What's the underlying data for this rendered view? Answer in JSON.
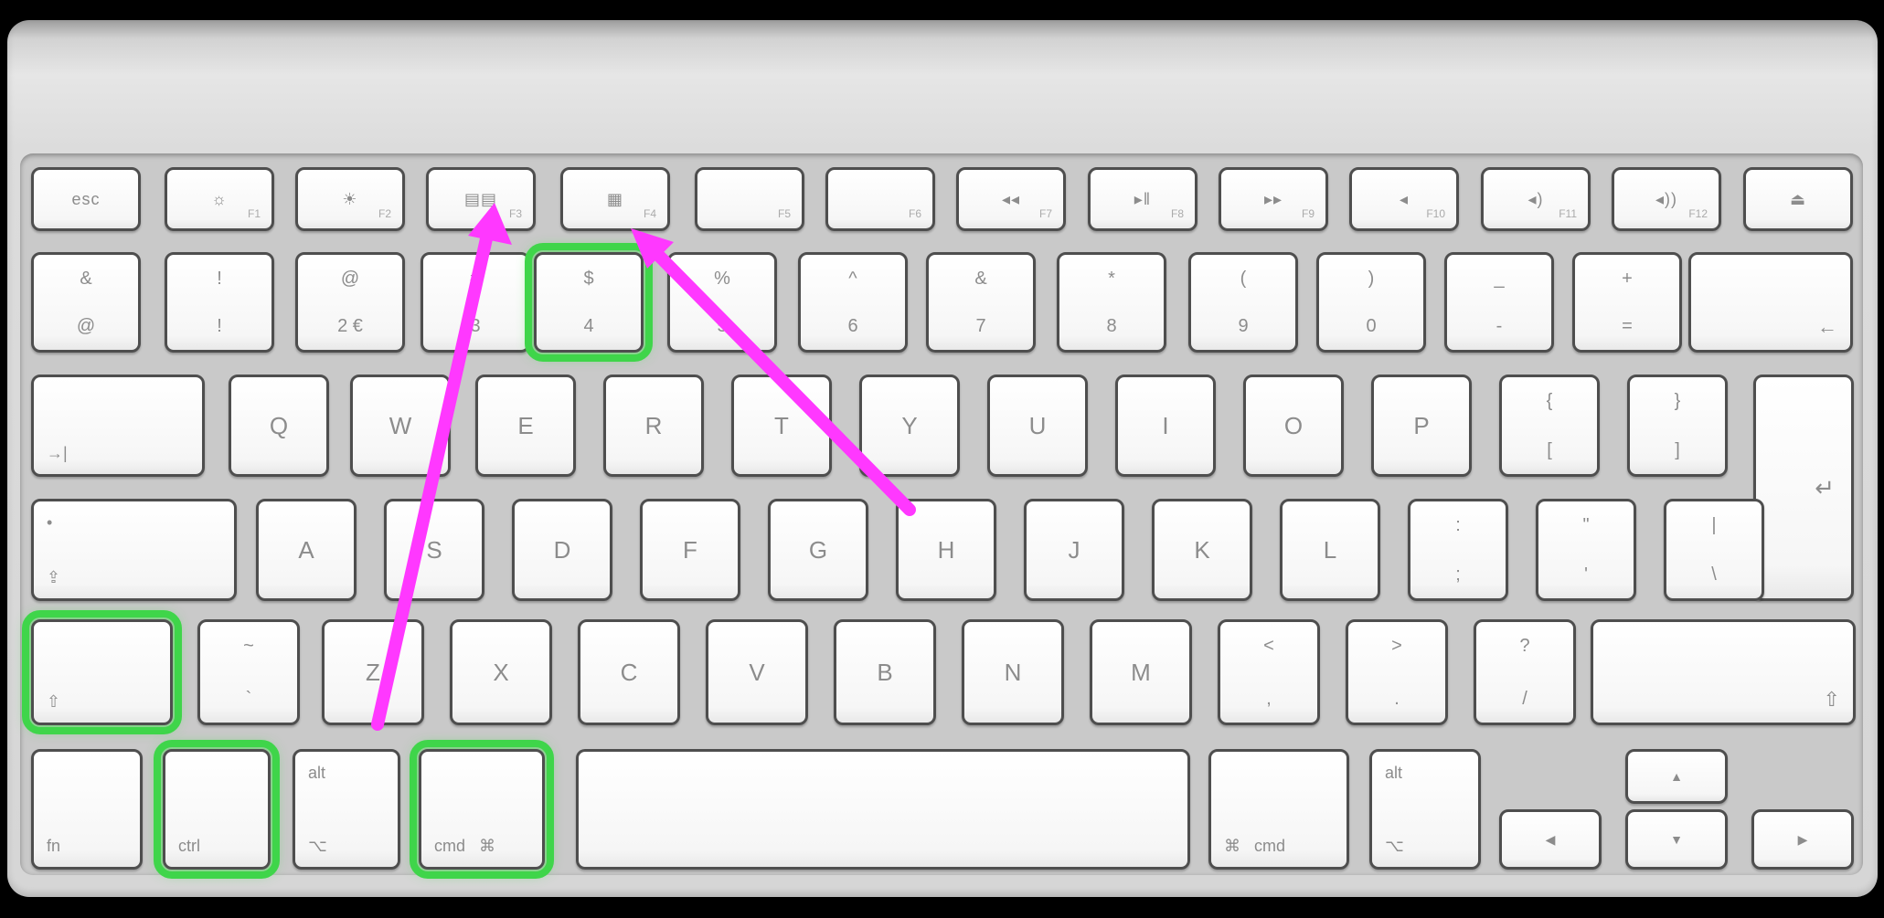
{
  "colors": {
    "background": "#000000",
    "keyboard": "#d9d9d9",
    "key_face": "#ffffff",
    "key_border": "#4e4e4e",
    "highlight": "#3fd54a",
    "arrow": "#ff38ff"
  },
  "function_row": [
    {
      "sym": "esc",
      "num": ""
    },
    {
      "sym": "☼",
      "num": "F1"
    },
    {
      "sym": "☀",
      "num": "F2"
    },
    {
      "sym": "▤▤",
      "num": "F3"
    },
    {
      "sym": "▦",
      "num": "F4"
    },
    {
      "sym": "",
      "num": "F5"
    },
    {
      "sym": "",
      "num": "F6"
    },
    {
      "sym": "◂◂",
      "num": "F7"
    },
    {
      "sym": "▸‖",
      "num": "F8"
    },
    {
      "sym": "▸▸",
      "num": "F9"
    },
    {
      "sym": "◂",
      "num": "F10"
    },
    {
      "sym": "◂)",
      "num": "F11"
    },
    {
      "sym": "◂))",
      "num": "F12"
    },
    {
      "sym": "⏏",
      "num": ""
    }
  ],
  "number_row": [
    {
      "top": "&",
      "bot": "@"
    },
    {
      "top": "!",
      "bot": "!"
    },
    {
      "top": "@",
      "bot": "2 €"
    },
    {
      "top": "#",
      "bot": "3"
    },
    {
      "top": "$",
      "bot": "4"
    },
    {
      "top": "%",
      "bot": "5"
    },
    {
      "top": "^",
      "bot": "6"
    },
    {
      "top": "&",
      "bot": "7"
    },
    {
      "top": "*",
      "bot": "8"
    },
    {
      "top": "(",
      "bot": "9"
    },
    {
      "top": ")",
      "bot": "0"
    },
    {
      "top": "_",
      "bot": "-"
    },
    {
      "top": "+",
      "bot": "="
    },
    {
      "top": "",
      "bot": "←"
    }
  ],
  "qwerty_row": [
    {
      "top": "",
      "bot": "→|"
    },
    {
      "top": "",
      "bot": "Q"
    },
    {
      "top": "",
      "bot": "W"
    },
    {
      "top": "",
      "bot": "E"
    },
    {
      "top": "",
      "bot": "R"
    },
    {
      "top": "",
      "bot": "T"
    },
    {
      "top": "",
      "bot": "Y"
    },
    {
      "top": "",
      "bot": "U"
    },
    {
      "top": "",
      "bot": "I"
    },
    {
      "top": "",
      "bot": "O"
    },
    {
      "top": "",
      "bot": "P"
    },
    {
      "top": "{",
      "bot": "["
    },
    {
      "top": "}",
      "bot": "]"
    },
    {
      "top": "",
      "bot": "↵"
    }
  ],
  "home_row": [
    {
      "top": "•",
      "bot": "⇪"
    },
    {
      "top": "",
      "bot": "A"
    },
    {
      "top": "",
      "bot": "S"
    },
    {
      "top": "",
      "bot": "D"
    },
    {
      "top": "",
      "bot": "F"
    },
    {
      "top": "",
      "bot": "G"
    },
    {
      "top": "",
      "bot": "H"
    },
    {
      "top": "",
      "bot": "J"
    },
    {
      "top": "",
      "bot": "K"
    },
    {
      "top": "",
      "bot": "L"
    },
    {
      "top": ":",
      "bot": ";"
    },
    {
      "top": "\"",
      "bot": "'"
    },
    {
      "top": "|",
      "bot": "\\"
    }
  ],
  "shift_row": [
    {
      "top": "",
      "bot": "⇧"
    },
    {
      "top": "~",
      "bot": "`"
    },
    {
      "top": "",
      "bot": "Z"
    },
    {
      "top": "",
      "bot": "X"
    },
    {
      "top": "",
      "bot": "C"
    },
    {
      "top": "",
      "bot": "V"
    },
    {
      "top": "",
      "bot": "B"
    },
    {
      "top": "",
      "bot": "N"
    },
    {
      "top": "",
      "bot": "M"
    },
    {
      "top": "<",
      "bot": ","
    },
    {
      "top": ">",
      "bot": "."
    },
    {
      "top": "?",
      "bot": "/"
    },
    {
      "top": "",
      "bot": "⇧"
    }
  ],
  "bottom_row": [
    {
      "top": "",
      "bot": "fn"
    },
    {
      "top": "",
      "bot": "ctrl"
    },
    {
      "top": "alt",
      "bot": "⌥"
    },
    {
      "top": "",
      "bot": "cmd   ⌘"
    },
    {
      "top": "",
      "bot": ""
    },
    {
      "top": "",
      "bot": "⌘   cmd"
    },
    {
      "top": "alt",
      "bot": "⌥"
    }
  ],
  "arrow_keys": {
    "up": "▲",
    "left": "◀",
    "down": "▼",
    "right": "▶"
  },
  "highlighted_keys": [
    "$ 4",
    "⇧ left",
    "ctrl",
    "cmd ⌘"
  ],
  "arrow_targets": [
    "F3",
    "F4"
  ]
}
